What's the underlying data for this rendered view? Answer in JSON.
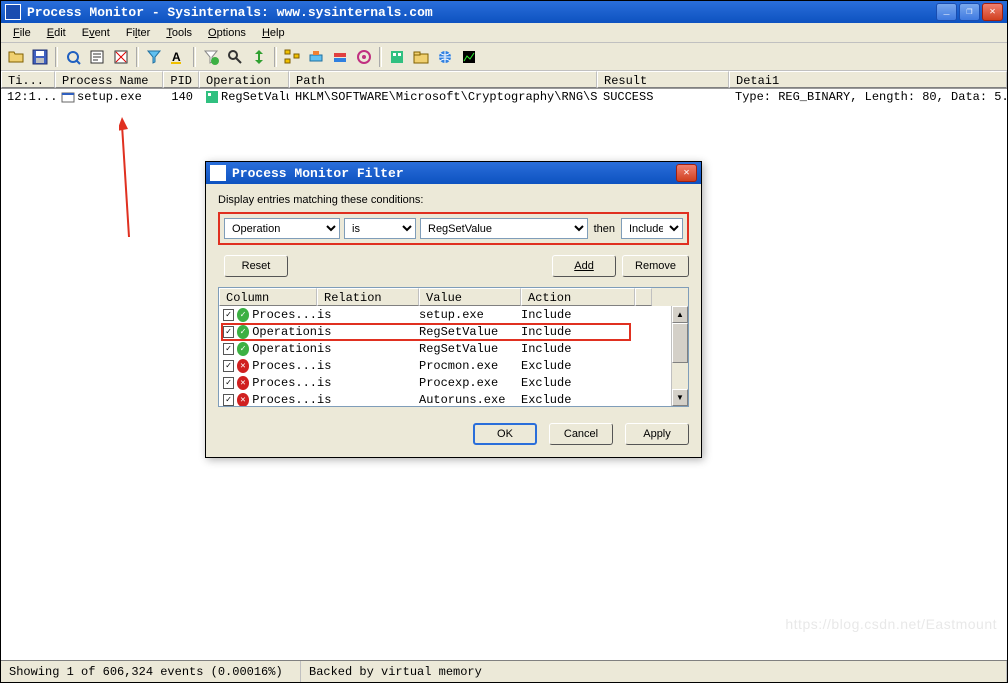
{
  "window": {
    "title": "Process Monitor - Sysinternals: www.sysinternals.com"
  },
  "menu": {
    "file": "File",
    "edit": "Edit",
    "event": "Event",
    "filter": "Filter",
    "tools": "Tools",
    "options": "Options",
    "help": "Help"
  },
  "columns": {
    "time": "Ti...",
    "process": "Process Name",
    "pid": "PID",
    "operation": "Operation",
    "path": "Path",
    "result": "Result",
    "detail": "Detai1"
  },
  "rows": [
    {
      "time": "12:1...",
      "process": "setup.exe",
      "pid": "140",
      "operation": "RegSetValue",
      "path": "HKLM\\SOFTWARE\\Microsoft\\Cryptography\\RNG\\Seed",
      "result": "SUCCESS",
      "detail": "Type: REG_BINARY, Length: 80, Data: 5..."
    }
  ],
  "status": {
    "left": "Showing 1 of 606,324 events (0.00016%)",
    "right": "Backed by virtual memory"
  },
  "dialog": {
    "title": "Process Monitor Filter",
    "label": "Display entries matching these conditions:",
    "combo1": "Operation",
    "combo2": "is",
    "combo3": "RegSetValue",
    "then": "then",
    "combo4": "Include",
    "btn_reset": "Reset",
    "btn_add": "Add",
    "btn_remove": "Remove",
    "list_head": {
      "col": "Column",
      "rel": "Relation",
      "val": "Value",
      "act": "Action"
    },
    "rules": [
      {
        "inc": true,
        "col": "Proces...",
        "rel": "is",
        "val": "setup.exe",
        "act": "Include"
      },
      {
        "inc": true,
        "col": "Operation",
        "rel": "is",
        "val": "RegSetValue",
        "act": "Include"
      },
      {
        "inc": true,
        "col": "Operation",
        "rel": "is",
        "val": "RegSetValue",
        "act": "Include"
      },
      {
        "inc": false,
        "col": "Proces...",
        "rel": "is",
        "val": "Procmon.exe",
        "act": "Exclude"
      },
      {
        "inc": false,
        "col": "Proces...",
        "rel": "is",
        "val": "Procexp.exe",
        "act": "Exclude"
      },
      {
        "inc": false,
        "col": "Proces...",
        "rel": "is",
        "val": "Autoruns.exe",
        "act": "Exclude"
      }
    ],
    "btn_ok": "OK",
    "btn_cancel": "Cancel",
    "btn_apply": "Apply"
  },
  "watermark": "https://blog.csdn.net/Eastmount"
}
